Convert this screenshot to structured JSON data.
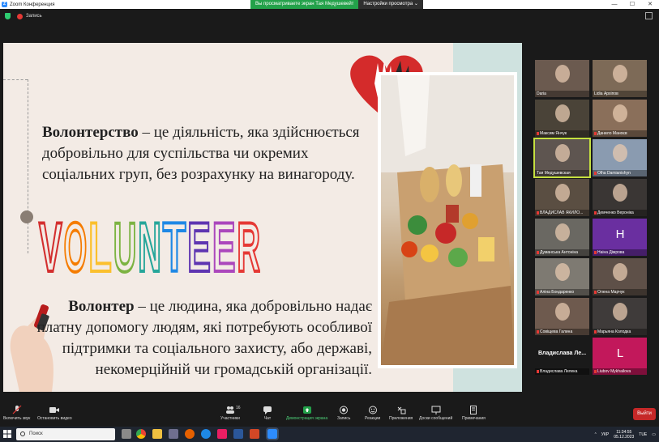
{
  "window": {
    "title": "Zoom Конференция",
    "share_banner": "Вы просматриваете экран Тая Медушевейт",
    "view_options": "Настройки просмотра",
    "controls": [
      "—",
      "☐",
      "✕"
    ]
  },
  "meeting": {
    "recording_label": "Запись"
  },
  "slide": {
    "para1_term": "Волонтерство",
    "para1_rest": " – це діяльність, яка здійснюється добровільно для суспільства чи окремих соціальних груп, без розрахунку на винагороду.",
    "big_word": "VOLUNTEER",
    "big_word_colors": [
      "#d32f2f",
      "#f57c00",
      "#fbc02d",
      "#7cb342",
      "#26a69a",
      "#1e88e5",
      "#5e35b1",
      "#ab47bc",
      "#e53935"
    ],
    "para2_term": "Волонтер",
    "para2_rest": " – це людина, яка добровільно надає платну допомогу людям, які потребують особливої підтримки та соціального захисту, або державі, некомерційній чи громадській організації."
  },
  "participants": [
    {
      "name": "Daria",
      "muted": false,
      "bg": "#6b5a4f"
    },
    {
      "name": "Lidia Архіпов",
      "muted": false,
      "bg": "#7d6a57"
    },
    {
      "name": "Максим Янчук",
      "muted": true,
      "bg": "#4a4338"
    },
    {
      "name": "Данило Маноєв",
      "muted": true,
      "bg": "#8a6f5a"
    },
    {
      "name": "Тая Медушевская",
      "muted": false,
      "bg": "#5e5550",
      "active": true
    },
    {
      "name": "Olha Damianishyn",
      "muted": true,
      "bg": "#8a9bb0"
    },
    {
      "name": "ВЛАДИСЛАВ ЯКИЛО...",
      "muted": true,
      "bg": "#5a4e42"
    },
    {
      "name": "Демченко Вероніка",
      "muted": true,
      "bg": "#3a3634"
    },
    {
      "name": "Думанська Антоніна",
      "muted": true,
      "bg": "#6a6862"
    },
    {
      "name": "Наіна Дімрова",
      "muted": true,
      "initial": "H",
      "bg": "#6a2fa0"
    },
    {
      "name": "Аліна Бондаренко",
      "muted": true,
      "bg": "#7e7a72"
    },
    {
      "name": "Олена Марчук",
      "muted": true,
      "bg": "#5e5048"
    },
    {
      "name": "Совіщева Галина",
      "muted": true,
      "bg": "#6e5a4e"
    },
    {
      "name": "Марьяна Колодка",
      "muted": true,
      "bg": "#3f3b3a"
    },
    {
      "name": "Владислава Лелека",
      "muted": true,
      "big": "Владислава Ле...",
      "bg": "#1a1a1a"
    },
    {
      "name": "Liubov Mykhailova",
      "muted": true,
      "initial": "L",
      "bg": "#c2185b"
    }
  ],
  "toolbar": {
    "mute": "Включить звук",
    "video": "Остановить видео",
    "participants": "Участники",
    "participants_count": "16",
    "chat": "Чат",
    "share": "Демонстрация экрана",
    "record": "Запись",
    "reactions": "Реакции",
    "apps": "Приложения",
    "whiteboard": "Доски сообщений",
    "notes": "Примечания",
    "leave": "Выйти"
  },
  "taskbar": {
    "search_placeholder": "Поиск",
    "lang": "УКР",
    "time": "11:34:55",
    "date": "05.12.2023",
    "day": "TUE"
  },
  "colors": {
    "share_green": "#23a14a",
    "leave_red": "#c62828",
    "active_border": "#c5e040"
  }
}
